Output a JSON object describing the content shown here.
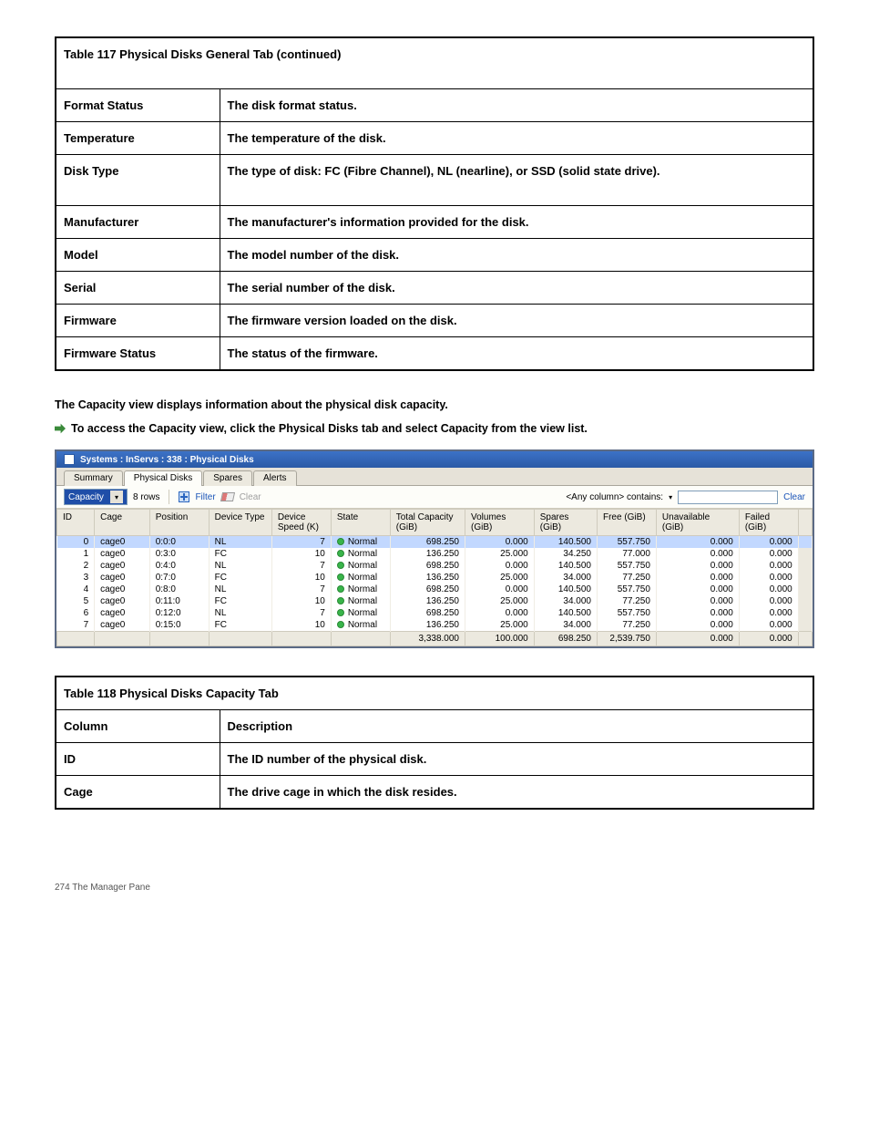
{
  "spec1": {
    "header": "Table 117 Physical Disks General Tab (continued)",
    "rows": [
      {
        "c1": "Format Status",
        "c2": "The disk format status."
      },
      {
        "c1": "Temperature",
        "c2": "The temperature of the disk."
      },
      {
        "c1": "Disk Type",
        "c2": "The type of disk: FC (Fibre Channel), NL (nearline), or SSD (solid state drive)."
      },
      {
        "c1": "Manufacturer",
        "c2": "The manufacturer's information provided for the disk."
      },
      {
        "c1": "Model",
        "c2": "The model number of the disk."
      },
      {
        "c1": "Serial",
        "c2": "The serial number of the disk."
      },
      {
        "c1": "Firmware",
        "c2": "The firmware version loaded on the disk."
      },
      {
        "c1": "Firmware Status",
        "c2": "The status of the firmware."
      }
    ]
  },
  "para1": "The Capacity view displays information about the physical disk capacity.",
  "arrow1": "To access the Capacity view, click the Physical Disks tab and select Capacity from the view list.",
  "window": {
    "title": "Systems : InServs : 338 : Physical Disks",
    "tabs": [
      "Summary",
      "Physical Disks",
      "Spares",
      "Alerts"
    ],
    "activeTab": 1,
    "combo": "Capacity",
    "rows": "8 rows",
    "filter": "Filter",
    "clear": "Clear",
    "anycol": "<Any column> contains:",
    "clear2": "Clear",
    "columns": [
      "ID",
      "Cage",
      "Position",
      "Device Type",
      "Device Speed (K)",
      "State",
      "Total Capacity (GiB)",
      "Volumes (GiB)",
      "Spares (GiB)",
      "Free (GiB)",
      "Unavailable (GiB)",
      "Failed (GiB)"
    ],
    "data": [
      {
        "id": "0",
        "cage": "cage0",
        "pos": "0:0:0",
        "dt": "NL",
        "spd": "7",
        "state": "Normal",
        "tot": "698.250",
        "vol": "0.000",
        "sp": "140.500",
        "free": "557.750",
        "un": "0.000",
        "fail": "0.000"
      },
      {
        "id": "1",
        "cage": "cage0",
        "pos": "0:3:0",
        "dt": "FC",
        "spd": "10",
        "state": "Normal",
        "tot": "136.250",
        "vol": "25.000",
        "sp": "34.250",
        "free": "77.000",
        "un": "0.000",
        "fail": "0.000"
      },
      {
        "id": "2",
        "cage": "cage0",
        "pos": "0:4:0",
        "dt": "NL",
        "spd": "7",
        "state": "Normal",
        "tot": "698.250",
        "vol": "0.000",
        "sp": "140.500",
        "free": "557.750",
        "un": "0.000",
        "fail": "0.000"
      },
      {
        "id": "3",
        "cage": "cage0",
        "pos": "0:7:0",
        "dt": "FC",
        "spd": "10",
        "state": "Normal",
        "tot": "136.250",
        "vol": "25.000",
        "sp": "34.000",
        "free": "77.250",
        "un": "0.000",
        "fail": "0.000"
      },
      {
        "id": "4",
        "cage": "cage0",
        "pos": "0:8:0",
        "dt": "NL",
        "spd": "7",
        "state": "Normal",
        "tot": "698.250",
        "vol": "0.000",
        "sp": "140.500",
        "free": "557.750",
        "un": "0.000",
        "fail": "0.000"
      },
      {
        "id": "5",
        "cage": "cage0",
        "pos": "0:11:0",
        "dt": "FC",
        "spd": "10",
        "state": "Normal",
        "tot": "136.250",
        "vol": "25.000",
        "sp": "34.000",
        "free": "77.250",
        "un": "0.000",
        "fail": "0.000"
      },
      {
        "id": "6",
        "cage": "cage0",
        "pos": "0:12:0",
        "dt": "NL",
        "spd": "7",
        "state": "Normal",
        "tot": "698.250",
        "vol": "0.000",
        "sp": "140.500",
        "free": "557.750",
        "un": "0.000",
        "fail": "0.000"
      },
      {
        "id": "7",
        "cage": "cage0",
        "pos": "0:15:0",
        "dt": "FC",
        "spd": "10",
        "state": "Normal",
        "tot": "136.250",
        "vol": "25.000",
        "sp": "34.000",
        "free": "77.250",
        "un": "0.000",
        "fail": "0.000"
      }
    ],
    "totals": {
      "tot": "3,338.000",
      "vol": "100.000",
      "sp": "698.250",
      "free": "2,539.750",
      "un": "0.000",
      "fail": "0.000"
    }
  },
  "spec2": {
    "header": "Table 118 Physical Disks Capacity Tab",
    "rows": [
      {
        "c1": "Column",
        "c2": "Description"
      },
      {
        "c1": "ID",
        "c2": "The ID number of the physical disk."
      },
      {
        "c1": "Cage",
        "c2": "The drive cage in which the disk resides."
      }
    ]
  },
  "footer": {
    "left": "274  The Manager Pane",
    "right": ""
  }
}
